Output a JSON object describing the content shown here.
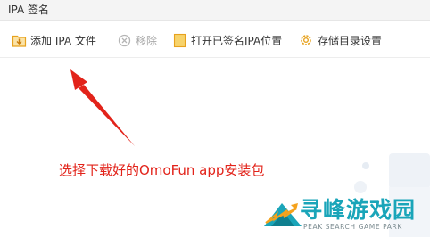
{
  "window": {
    "title": "IPA 签名"
  },
  "toolbar": {
    "add_ipa": {
      "label": "添加 IPA 文件",
      "icon": "folder-import-icon"
    },
    "remove": {
      "label": "移除",
      "icon": "remove-icon",
      "disabled": true
    },
    "open_folder": {
      "label": "打开已签名IPA位置",
      "icon": "folder-icon"
    },
    "storage_settings": {
      "label": "存储目录设置",
      "icon": "gear-icon"
    }
  },
  "annotation": {
    "text": "选择下载好的OmoFun app安装包",
    "color": "#e2231a"
  },
  "watermark": {
    "title": "寻峰游戏园",
    "subtitle": "PEAK SEARCH GAME PARK"
  },
  "colors": {
    "accent_orange": "#e7a21e",
    "annotation_red": "#e2231a",
    "watermark_teal": "#1aa5b9"
  }
}
